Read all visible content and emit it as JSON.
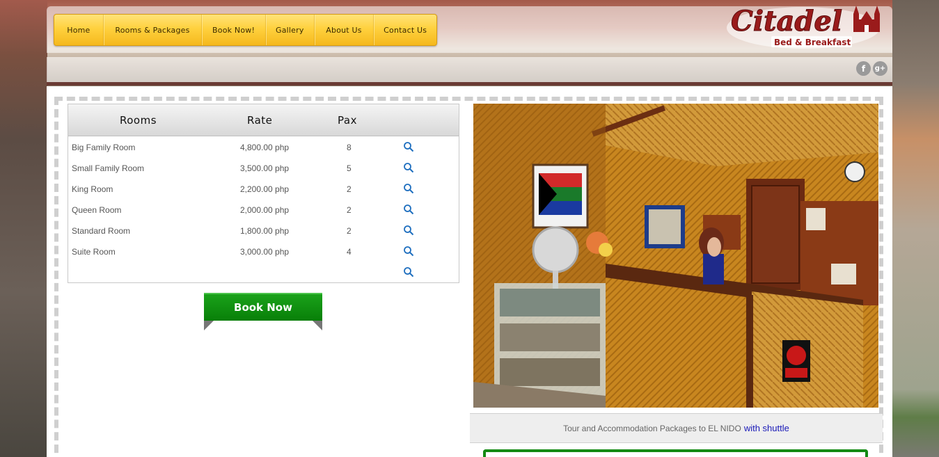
{
  "nav": {
    "items": [
      {
        "label": "Home"
      },
      {
        "label": "Rooms & Packages"
      },
      {
        "label": "Book Now!"
      },
      {
        "label": "Gallery"
      },
      {
        "label": "About Us"
      },
      {
        "label": "Contact Us"
      }
    ]
  },
  "logo": {
    "name": "Citadel",
    "tagline": "Bed & Breakfast"
  },
  "social": {
    "facebook": "f",
    "googleplus": "g+"
  },
  "rooms_table": {
    "headers": {
      "rooms": "Rooms",
      "rate": "Rate",
      "pax": "Pax"
    },
    "rows": [
      {
        "name": "Big Family Room",
        "rate": "4,800.00 php",
        "pax": "8"
      },
      {
        "name": "Small Family Room",
        "rate": "3,500.00 php",
        "pax": "5"
      },
      {
        "name": "King Room",
        "rate": "2,200.00 php",
        "pax": "2"
      },
      {
        "name": "Queen Room",
        "rate": "2,000.00 php",
        "pax": "2"
      },
      {
        "name": "Standard Room",
        "rate": "1,800.00 php",
        "pax": "2"
      },
      {
        "name": "Suite Room",
        "rate": "3,000.00 php",
        "pax": "4"
      },
      {
        "name": "",
        "rate": "",
        "pax": ""
      }
    ]
  },
  "book_button": {
    "label": "Book Now"
  },
  "tour": {
    "text": "Tour and Accommodation Packages to EL NIDO",
    "link": "with shuttle"
  },
  "colors": {
    "nav_yellow": "#ffd13e",
    "book_green": "#087f08",
    "logo_red": "#9a1b1b",
    "link_blue": "#1a1ab8"
  }
}
